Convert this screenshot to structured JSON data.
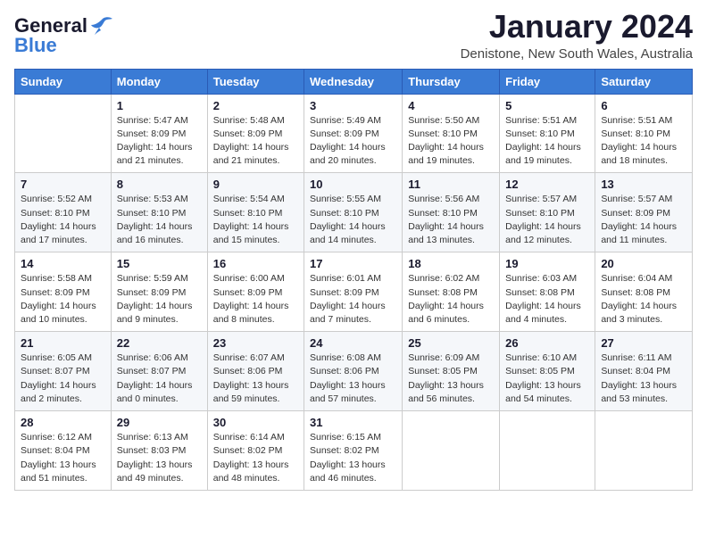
{
  "header": {
    "logo_general": "General",
    "logo_blue": "Blue",
    "month_title": "January 2024",
    "location": "Denistone, New South Wales, Australia"
  },
  "weekdays": [
    "Sunday",
    "Monday",
    "Tuesday",
    "Wednesday",
    "Thursday",
    "Friday",
    "Saturday"
  ],
  "weeks": [
    [
      {
        "day": "",
        "info": ""
      },
      {
        "day": "1",
        "info": "Sunrise: 5:47 AM\nSunset: 8:09 PM\nDaylight: 14 hours\nand 21 minutes."
      },
      {
        "day": "2",
        "info": "Sunrise: 5:48 AM\nSunset: 8:09 PM\nDaylight: 14 hours\nand 21 minutes."
      },
      {
        "day": "3",
        "info": "Sunrise: 5:49 AM\nSunset: 8:09 PM\nDaylight: 14 hours\nand 20 minutes."
      },
      {
        "day": "4",
        "info": "Sunrise: 5:50 AM\nSunset: 8:10 PM\nDaylight: 14 hours\nand 19 minutes."
      },
      {
        "day": "5",
        "info": "Sunrise: 5:51 AM\nSunset: 8:10 PM\nDaylight: 14 hours\nand 19 minutes."
      },
      {
        "day": "6",
        "info": "Sunrise: 5:51 AM\nSunset: 8:10 PM\nDaylight: 14 hours\nand 18 minutes."
      }
    ],
    [
      {
        "day": "7",
        "info": "Sunrise: 5:52 AM\nSunset: 8:10 PM\nDaylight: 14 hours\nand 17 minutes."
      },
      {
        "day": "8",
        "info": "Sunrise: 5:53 AM\nSunset: 8:10 PM\nDaylight: 14 hours\nand 16 minutes."
      },
      {
        "day": "9",
        "info": "Sunrise: 5:54 AM\nSunset: 8:10 PM\nDaylight: 14 hours\nand 15 minutes."
      },
      {
        "day": "10",
        "info": "Sunrise: 5:55 AM\nSunset: 8:10 PM\nDaylight: 14 hours\nand 14 minutes."
      },
      {
        "day": "11",
        "info": "Sunrise: 5:56 AM\nSunset: 8:10 PM\nDaylight: 14 hours\nand 13 minutes."
      },
      {
        "day": "12",
        "info": "Sunrise: 5:57 AM\nSunset: 8:10 PM\nDaylight: 14 hours\nand 12 minutes."
      },
      {
        "day": "13",
        "info": "Sunrise: 5:57 AM\nSunset: 8:09 PM\nDaylight: 14 hours\nand 11 minutes."
      }
    ],
    [
      {
        "day": "14",
        "info": "Sunrise: 5:58 AM\nSunset: 8:09 PM\nDaylight: 14 hours\nand 10 minutes."
      },
      {
        "day": "15",
        "info": "Sunrise: 5:59 AM\nSunset: 8:09 PM\nDaylight: 14 hours\nand 9 minutes."
      },
      {
        "day": "16",
        "info": "Sunrise: 6:00 AM\nSunset: 8:09 PM\nDaylight: 14 hours\nand 8 minutes."
      },
      {
        "day": "17",
        "info": "Sunrise: 6:01 AM\nSunset: 8:09 PM\nDaylight: 14 hours\nand 7 minutes."
      },
      {
        "day": "18",
        "info": "Sunrise: 6:02 AM\nSunset: 8:08 PM\nDaylight: 14 hours\nand 6 minutes."
      },
      {
        "day": "19",
        "info": "Sunrise: 6:03 AM\nSunset: 8:08 PM\nDaylight: 14 hours\nand 4 minutes."
      },
      {
        "day": "20",
        "info": "Sunrise: 6:04 AM\nSunset: 8:08 PM\nDaylight: 14 hours\nand 3 minutes."
      }
    ],
    [
      {
        "day": "21",
        "info": "Sunrise: 6:05 AM\nSunset: 8:07 PM\nDaylight: 14 hours\nand 2 minutes."
      },
      {
        "day": "22",
        "info": "Sunrise: 6:06 AM\nSunset: 8:07 PM\nDaylight: 14 hours\nand 0 minutes."
      },
      {
        "day": "23",
        "info": "Sunrise: 6:07 AM\nSunset: 8:06 PM\nDaylight: 13 hours\nand 59 minutes."
      },
      {
        "day": "24",
        "info": "Sunrise: 6:08 AM\nSunset: 8:06 PM\nDaylight: 13 hours\nand 57 minutes."
      },
      {
        "day": "25",
        "info": "Sunrise: 6:09 AM\nSunset: 8:05 PM\nDaylight: 13 hours\nand 56 minutes."
      },
      {
        "day": "26",
        "info": "Sunrise: 6:10 AM\nSunset: 8:05 PM\nDaylight: 13 hours\nand 54 minutes."
      },
      {
        "day": "27",
        "info": "Sunrise: 6:11 AM\nSunset: 8:04 PM\nDaylight: 13 hours\nand 53 minutes."
      }
    ],
    [
      {
        "day": "28",
        "info": "Sunrise: 6:12 AM\nSunset: 8:04 PM\nDaylight: 13 hours\nand 51 minutes."
      },
      {
        "day": "29",
        "info": "Sunrise: 6:13 AM\nSunset: 8:03 PM\nDaylight: 13 hours\nand 49 minutes."
      },
      {
        "day": "30",
        "info": "Sunrise: 6:14 AM\nSunset: 8:02 PM\nDaylight: 13 hours\nand 48 minutes."
      },
      {
        "day": "31",
        "info": "Sunrise: 6:15 AM\nSunset: 8:02 PM\nDaylight: 13 hours\nand 46 minutes."
      },
      {
        "day": "",
        "info": ""
      },
      {
        "day": "",
        "info": ""
      },
      {
        "day": "",
        "info": ""
      }
    ]
  ]
}
